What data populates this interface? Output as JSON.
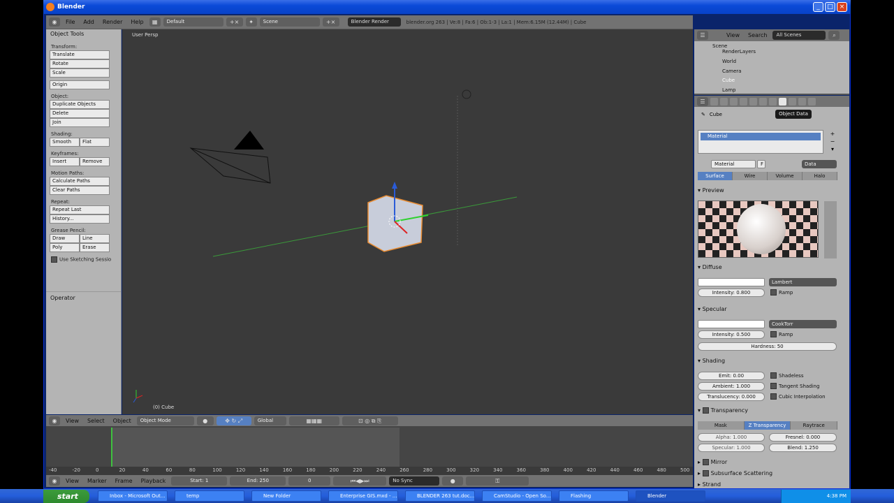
{
  "window": {
    "title": "Blender"
  },
  "topbar": {
    "menus": [
      "File",
      "Add",
      "Render",
      "Help"
    ],
    "layout": "Default",
    "scene": "Scene",
    "engine": "Blender Render",
    "info": "blender.org 263 | Ve:8 | Fa:6 | Ob:1-3 | La:1 | Mem:6.15M (12.44M) | Cube"
  },
  "toolshelf": {
    "title": "Object Tools",
    "transform_label": "Transform:",
    "translate": "Translate",
    "rotate": "Rotate",
    "scale": "Scale",
    "origin": "Origin",
    "object_label": "Object:",
    "duplicate": "Duplicate Objects",
    "delete": "Delete",
    "join": "Join",
    "shading_label": "Shading:",
    "smooth": "Smooth",
    "flat": "Flat",
    "keyframes_label": "Keyframes:",
    "insert": "Insert",
    "remove": "Remove",
    "motion_label": "Motion Paths:",
    "calc_paths": "Calculate Paths",
    "clear_paths": "Clear Paths",
    "repeat_label": "Repeat:",
    "repeat_last": "Repeat Last",
    "history": "History...",
    "grease_label": "Grease Pencil:",
    "draw": "Draw",
    "line": "Line",
    "poly": "Poly",
    "erase": "Erase",
    "sketching": "Use Sketching Sessio",
    "operator": "Operator"
  },
  "viewport": {
    "view_name": "User Persp",
    "object_label": "(0) Cube"
  },
  "header3d": {
    "menus": [
      "View",
      "Select",
      "Object"
    ],
    "mode": "Object Mode",
    "orientation": "Global"
  },
  "timeline": {
    "ticks": [
      "-40",
      "-20",
      "0",
      "20",
      "40",
      "60",
      "80",
      "100",
      "120",
      "140",
      "160",
      "180",
      "200",
      "220",
      "240",
      "260",
      "280",
      "300",
      "320",
      "340",
      "360",
      "380",
      "400",
      "420",
      "440",
      "460",
      "480",
      "500"
    ],
    "menus": [
      "View",
      "Marker",
      "Frame",
      "Playback"
    ],
    "start": "Start: 1",
    "end": "End: 250",
    "current": "0",
    "sync": "No Sync"
  },
  "outliner": {
    "menus": [
      "View",
      "Search"
    ],
    "scope": "All Scenes",
    "items": [
      "Scene",
      "RenderLayers",
      "World",
      "Camera",
      "Cube",
      "Lamp"
    ]
  },
  "properties": {
    "tooltip": "Object Data",
    "breadcrumb": "Cube",
    "material_slot": "Material",
    "material_name": "Material",
    "fake_user": "F",
    "link": "Data",
    "tabs": [
      "Surface",
      "Wire",
      "Volume",
      "Halo"
    ],
    "preview": "Preview",
    "diffuse": "Diffuse",
    "diffuse_shader": "Lambert",
    "diffuse_intensity": "Intensity: 0.800",
    "ramp": "Ramp",
    "specular": "Specular",
    "spec_shader": "CookTorr",
    "spec_intensity": "Intensity: 0.500",
    "hardness": "Hardness: 50",
    "shading": "Shading",
    "emit": "Emit: 0.00",
    "ambient": "Ambient: 1.000",
    "translucency": "Translucency: 0.000",
    "shadeless": "Shadeless",
    "tangent": "Tangent Shading",
    "cubic": "Cubic Interpolation",
    "transparency": "Transparency",
    "trans_tabs": [
      "Mask",
      "Z Transparency",
      "Raytrace"
    ],
    "alpha": "Alpha: 1.000",
    "fresnel": "Fresnel: 0.000",
    "specular_t": "Specular: 1.000",
    "blend": "Blend: 1.250",
    "mirror": "Mirror",
    "sss": "Subsurface Scattering",
    "strand": "Strand"
  },
  "taskbar": {
    "start": "start",
    "tasks": [
      "Inbox - Microsoft Out...",
      "temp",
      "New Folder",
      "Enterprise GIS.mxd - ...",
      "BLENDER 263 tut.doc...",
      "CamStudio - Open So...",
      "Flashing",
      "Blender"
    ],
    "clock": "4:38 PM"
  }
}
